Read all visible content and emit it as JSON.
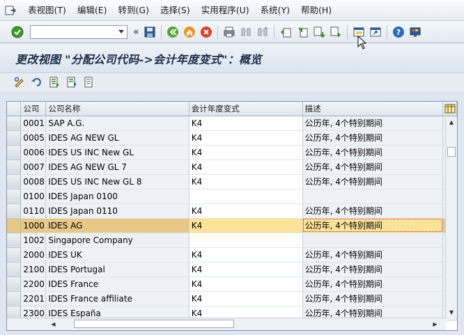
{
  "menu": {
    "items": [
      "表视图(T)",
      "编辑(E)",
      "转到(G)",
      "选择(S)",
      "实用程序(U)",
      "系统(Y)",
      "帮助(H)"
    ]
  },
  "toolbar": {
    "command_value": "",
    "icons": [
      "enter-icon",
      "save-icon",
      "back-icon",
      "exit-icon",
      "cancel-icon",
      "print-icon",
      "find-icon",
      "find-next-icon",
      "first-page-icon",
      "prev-page-icon",
      "next-page-icon",
      "last-page-icon",
      "create-session-icon",
      "shortcut-icon",
      "help-icon",
      "customize-icon"
    ]
  },
  "page": {
    "title": "更改视图 \"分配公司代码->会计年度变式\"：概览"
  },
  "table": {
    "columns": [
      "公司",
      "公司名称",
      "会计年度变式",
      "描述"
    ],
    "rows": [
      {
        "code": "0001",
        "name": "SAP A.G.",
        "variant": "K4",
        "desc": "公历年, 4个特别期间"
      },
      {
        "code": "0005",
        "name": "IDES AG NEW GL",
        "variant": "K4",
        "desc": "公历年, 4个特别期间"
      },
      {
        "code": "0006",
        "name": "IDES US INC New GL",
        "variant": "K4",
        "desc": "公历年, 4个特别期间"
      },
      {
        "code": "0007",
        "name": "IDES AG NEW GL 7",
        "variant": "K4",
        "desc": "公历年, 4个特别期间"
      },
      {
        "code": "0008",
        "name": "IDES US INC New GL 8",
        "variant": "K4",
        "desc": "公历年, 4个特别期间"
      },
      {
        "code": "0100",
        "name": "IDES Japan 0100",
        "variant": "",
        "desc": ""
      },
      {
        "code": "0110",
        "name": "IDES Japan 0110",
        "variant": "K4",
        "desc": "公历年, 4个特别期间"
      },
      {
        "code": "1000",
        "name": "IDES AG",
        "variant": "K4",
        "desc": "公历年, 4个特别期间"
      },
      {
        "code": "1002",
        "name": "Singapore Company",
        "variant": "",
        "desc": ""
      },
      {
        "code": "2000",
        "name": "IDES UK",
        "variant": "K4",
        "desc": "公历年, 4个特别期间"
      },
      {
        "code": "2100",
        "name": "IDES Portugal",
        "variant": "K4",
        "desc": "公历年, 4个特别期间"
      },
      {
        "code": "2200",
        "name": "IDES France",
        "variant": "K4",
        "desc": "公历年, 4个特别期间"
      },
      {
        "code": "2201",
        "name": "IDES France affiliate",
        "variant": "K4",
        "desc": "公历年, 4个特别期间"
      },
      {
        "code": "2300",
        "name": "IDES España",
        "variant": "K4",
        "desc": "公历年, 4个特别期间"
      }
    ],
    "highlighted_row": 7
  },
  "colors": {
    "highlight": "#e8c886",
    "highlight_edit": "#fbe39a",
    "title_text": "#1c2d48"
  }
}
